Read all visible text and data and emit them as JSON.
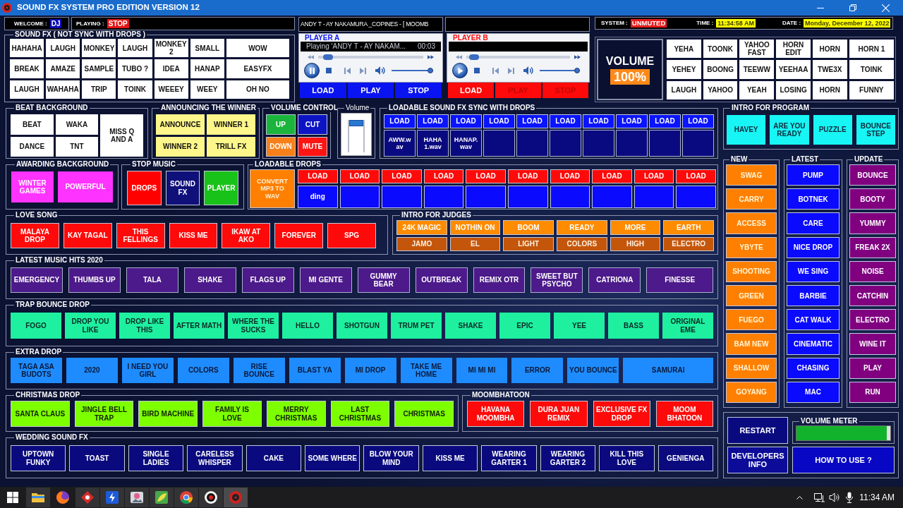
{
  "window": {
    "title": "SOUND FX SYSTEM PRO EDITION VERSION 12"
  },
  "status": {
    "welcome": {
      "label": "WELCOME :",
      "value": "DJ"
    },
    "playing": {
      "label": "PLAYING :",
      "value": "STOP"
    },
    "now_playing": "ANDY T - AY NAKAMURA _COPINES - [ MOOMB",
    "system": {
      "label": "SYSTEM :",
      "value": "UNMUTED"
    },
    "time": {
      "label": "TIME :",
      "value": "11:34:58 AM"
    },
    "date": {
      "label": "DATE :",
      "value": "Monday, December 12, 2022"
    }
  },
  "sound_fx": {
    "title": "SOUND FX ( NOT SYNC WITH DROPS )",
    "buttons": [
      "HAHAHA",
      "LAUGH",
      "MONKEY",
      "LAUGH",
      "MONKEY 2",
      "SMALL",
      "WOW",
      "BREAK",
      "AMAZE",
      "SAMPLE",
      "TUBO ?",
      "IDEA",
      "HANAP",
      "EASYFX",
      "LAUGH",
      "WAHAHA",
      "TRIP",
      "TOINK",
      "WEEEY",
      "WEEY",
      "OH NO"
    ]
  },
  "players": [
    {
      "title": "PLAYER A",
      "color": "#0a14f0",
      "display_text": "Playing 'ANDY T - AY NAKAM...",
      "display_time": "00:03",
      "playing": true,
      "seek": {
        "level": 0.05
      },
      "volume": {
        "level": 1
      },
      "buttons": [
        {
          "label": "LOAD",
          "disabled": false
        },
        {
          "label": "PLAY",
          "disabled": false
        },
        {
          "label": "STOP",
          "disabled": false
        }
      ]
    },
    {
      "title": "PLAYER B",
      "color": "#ff0a0a",
      "playing": false,
      "seek": {
        "level": 0.03
      },
      "volume": {
        "level": 1
      },
      "buttons": [
        {
          "label": "LOAD",
          "disabled": false
        },
        {
          "label": "PLAY",
          "disabled": true
        },
        {
          "label": "STOP",
          "disabled": true
        }
      ]
    }
  ],
  "volume_display": {
    "label": "VOLUME",
    "value": "100%"
  },
  "quick_fx": [
    "YEHA",
    "TOONK",
    "YAHOO FAST",
    "HORN EDIT",
    "HORN",
    "HORN 1",
    "YEHEY",
    "BOONG",
    "TEEWW",
    "YEEHAA",
    "TWE3X",
    "TOINK",
    "LAUGH",
    "YAHOO",
    "YEAH",
    "LOSING",
    "HORN",
    "FUNNY"
  ],
  "beat_background": {
    "title": "BEAT BACKGROUND",
    "buttons": [
      "BEAT",
      "WAKA",
      "MISS Q AND A",
      "DANCE",
      "TNT"
    ]
  },
  "announcing_the_winner": {
    "title": "ANNOUNCING THE WINNER",
    "buttons": [
      "ANNOUNCE",
      "WINNER 1",
      "WINNER 2",
      "TRILL FX"
    ]
  },
  "volume_control": {
    "title": "VOLUME CONTROL",
    "buttons": [
      {
        "label": "UP",
        "color": "#1bb43c"
      },
      {
        "label": "CUT",
        "color": "#0c14c4"
      },
      {
        "label": "DOWN",
        "color": "#f7801a"
      },
      {
        "label": "MUTE",
        "color": "#ff1414"
      }
    ]
  },
  "volume_slider": {
    "title": "Volume",
    "level": 1
  },
  "loadable_sound_fx": {
    "title": "LOADABLE SOUND FX SYNC WITH DROPS",
    "slots": [
      {
        "button": "LOAD",
        "file": "AWW.wav"
      },
      {
        "button": "LOAD",
        "file": "HAHA 1.wav"
      },
      {
        "button": "LOAD",
        "file": "HANAP.wav"
      },
      {
        "button": "LOAD"
      },
      {
        "button": "LOAD"
      },
      {
        "button": "LOAD"
      },
      {
        "button": "LOAD"
      },
      {
        "button": "LOAD"
      },
      {
        "button": "LOAD"
      },
      {
        "button": "LOAD"
      }
    ]
  },
  "intro_for_program": {
    "title": "INTRO FOR PROGRAM",
    "buttons": [
      "HAVEY",
      "ARE YOU READY",
      "PUZZLE",
      "BOUNCE STEP"
    ]
  },
  "awarding_background": {
    "title": "AWARDING BACKGROUND",
    "buttons": [
      "WINTER GAMES",
      "POWERFUL"
    ]
  },
  "stop_music": {
    "title": "STOP MUSIC",
    "buttons": [
      {
        "label": "DROPS",
        "color": "#ff0000"
      },
      {
        "label": "SOUND FX",
        "color": "#10107a"
      },
      {
        "label": "PLAYER",
        "color": "#19c219"
      }
    ]
  },
  "loadable_drops": {
    "title": "LOADABLE DROPS",
    "convert_button": "CONVERT MP3 TO WAV",
    "slots": [
      {
        "button": "LOAD",
        "file": "ding"
      },
      {
        "button": "LOAD"
      },
      {
        "button": "LOAD"
      },
      {
        "button": "LOAD"
      },
      {
        "button": "LOAD"
      },
      {
        "button": "LOAD"
      },
      {
        "button": "LOAD"
      },
      {
        "button": "LOAD"
      },
      {
        "button": "LOAD"
      },
      {
        "button": "LOAD"
      }
    ]
  },
  "love_song": {
    "title": "LOVE SONG",
    "buttons": [
      "MALAYA DROP",
      "KAY TAGAL",
      "THIS FELLINGS",
      "KISS ME",
      "IKAW AT AKO",
      "FOREVER",
      "SPG"
    ]
  },
  "intro_for_judges": {
    "title": "INTRO FOR JUDGES",
    "rows": [
      [
        "24K MAGIC",
        "NOTHIN ON",
        "BOOM",
        "READY",
        "MORE",
        "EARTH"
      ],
      [
        "JAMO",
        "EL",
        "LIGHT",
        "COLORS",
        "HIGH",
        "ELECTRO"
      ]
    ]
  },
  "latest_music_hits": {
    "title": "LATEST MUSIC HITS 2020",
    "buttons": [
      "EMERGENCY",
      "THUMBS UP",
      "TALA",
      "SHAKE",
      "FLAGS UP",
      "MI GENTE",
      "GUMMY BEAR",
      "OUTBREAK",
      "REMIX OTR",
      "SWEET BUT PSYCHO",
      "CATRIONA",
      "FINESSE"
    ]
  },
  "trap_bounce_drop": {
    "title": "TRAP BOUNCE DROP",
    "buttons": [
      "FOGO",
      "DROP YOU LIKE",
      "DROP LIKE THIS",
      "AFTER MATH",
      "WHERE THE SUCKS",
      "HELLO",
      "SHOTGUN",
      "TRUM PET",
      "SHAKE",
      "EPIC",
      "YEE",
      "BASS",
      "ORIGINAL EME"
    ]
  },
  "extra_drop": {
    "title": "EXTRA DROP",
    "buttons": [
      "TAGA ASA BUDOTS",
      "2020",
      "I NEED YOU GIRL",
      "COLORS",
      "RISE BOUNCE",
      "BLAST YA",
      "MI DROP",
      "TAKE ME HOME",
      "MI MI MI",
      "ERROR",
      "YOU BOUNCE",
      "SAMURAI"
    ]
  },
  "christmas_drop": {
    "title": "CHRISTMAS DROP",
    "buttons": [
      "SANTA CLAUS",
      "JINGLE BELL TRAP",
      "BIRD MACHINE",
      "FAMILY IS LOVE",
      "MERRY CHRISTMAS",
      "LAST CHRISTMAS",
      "CHRISTMAS"
    ]
  },
  "moombhatoon": {
    "title": "MOOMBHATOON",
    "buttons": [
      "HAVANA MOOMBHA",
      "DURA JUAN REMIX",
      "EXCLUSIVE FX DROP",
      "MOOM BHATOON"
    ]
  },
  "wedding_sound_fx": {
    "title": "WEDDING SOUND FX",
    "buttons": [
      "UPTOWN FUNKY",
      "TOAST",
      "SINGLE LADIES",
      "CARELESS WHISPER",
      "CAKE",
      "SOME WHERE",
      "BLOW YOUR MIND",
      "KISS ME",
      "WEARING GARTER 1",
      "WEARING GARTER 2",
      "KILL THIS LOVE",
      "GENIENGA"
    ]
  },
  "new": {
    "title": "NEW",
    "buttons": [
      "SWAG",
      "CARRY",
      "ACCESS",
      "YBYTE",
      "SHOOTING",
      "GREEN",
      "FUEGO",
      "BAM NEW",
      "SHALLOW",
      "GOYANG"
    ]
  },
  "latest": {
    "title": "LATEST",
    "buttons": [
      "PUMP",
      "BOTNEK",
      "CARE",
      "NICE DROP",
      "WE SING",
      "BARBIE",
      "CAT WALK",
      "CINEMATIC",
      "CHASING",
      "MAC"
    ]
  },
  "update": {
    "title": "UPDATE",
    "buttons": [
      "BOUNCE",
      "BOOTY",
      "YUMMY",
      "FREAK 2X",
      "NOISE",
      "CATCHIN",
      "ELECTRO",
      "WINE IT",
      "PLAY",
      "RUN"
    ]
  },
  "restart_button": "RESTART",
  "volume_meter": {
    "title": "VOLUME METER",
    "level": 0.96
  },
  "developers_info_button": "DEVELOPERS INFO",
  "how_to_use_button": "HOW TO USE ?",
  "taskbar": {
    "apps": [
      {
        "kind": "folder",
        "open": true,
        "selected": false
      },
      {
        "kind": "globe",
        "open": false,
        "selected": false
      },
      {
        "kind": "diamond",
        "open": true,
        "selected": false
      },
      {
        "kind": "bolt",
        "open": true,
        "selected": false
      },
      {
        "kind": "picture",
        "open": true,
        "selected": false
      },
      {
        "kind": "leaf",
        "open": true,
        "selected": false
      },
      {
        "kind": "wheel",
        "open": true,
        "selected": false
      },
      {
        "kind": "record",
        "open": true,
        "selected": false
      },
      {
        "kind": "disc",
        "open": true,
        "selected": true
      }
    ],
    "clock": "11:34 AM"
  }
}
